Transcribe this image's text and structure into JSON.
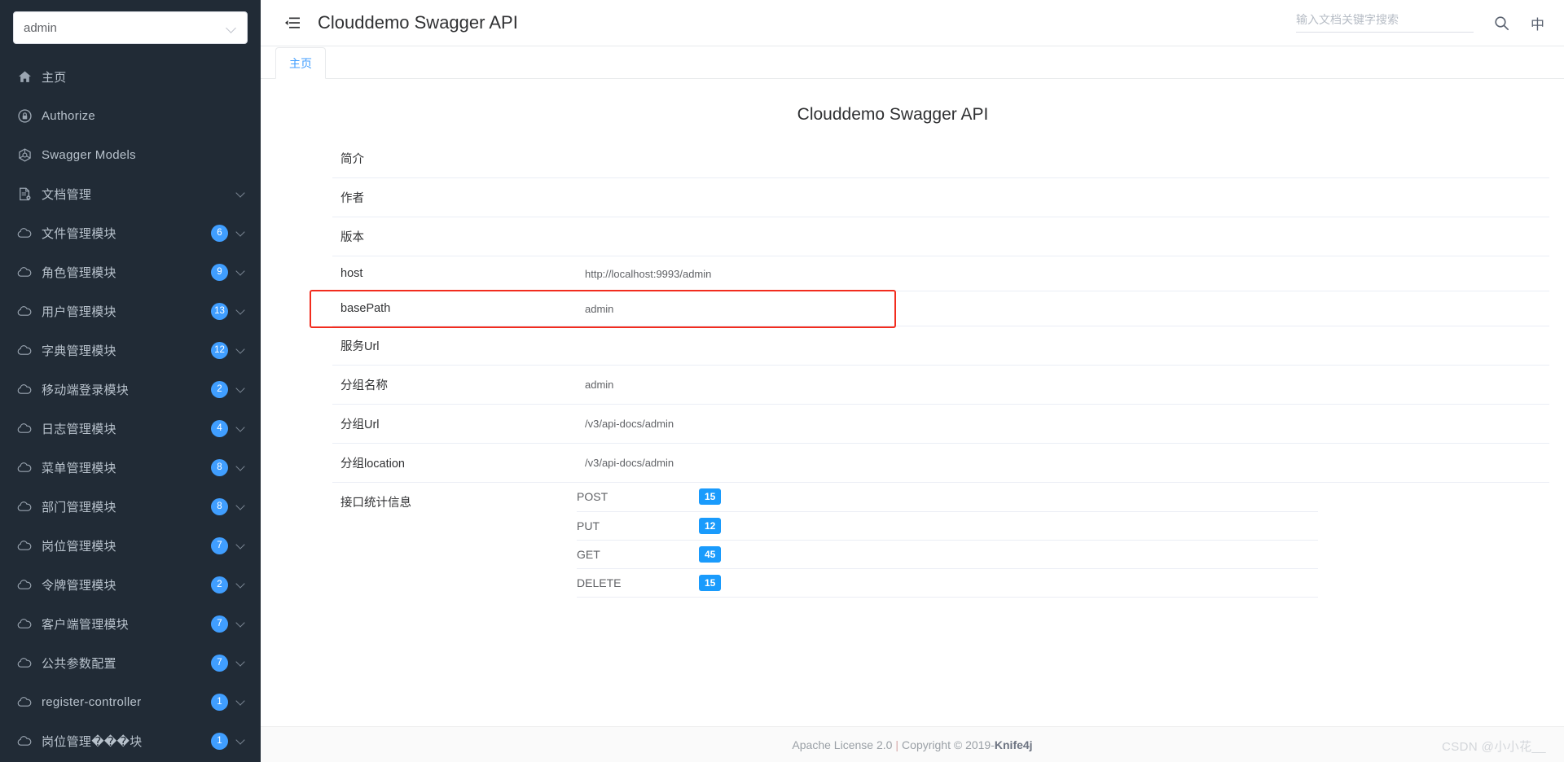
{
  "sidebar": {
    "group_select": {
      "value": "admin",
      "icon": "chevron-down-icon"
    },
    "items": [
      {
        "label": "主页",
        "icon": "home-icon",
        "badge": null,
        "chevron": false
      },
      {
        "label": "Authorize",
        "icon": "lock-icon",
        "badge": null,
        "chevron": false
      },
      {
        "label": "Swagger Models",
        "icon": "model-icon",
        "badge": null,
        "chevron": false
      },
      {
        "label": "文档管理",
        "icon": "document-icon",
        "badge": null,
        "chevron": true
      },
      {
        "label": "文件管理模块",
        "icon": "cloud-icon",
        "badge": "6",
        "chevron": true
      },
      {
        "label": "角色管理模块",
        "icon": "cloud-icon",
        "badge": "9",
        "chevron": true
      },
      {
        "label": "用户管理模块",
        "icon": "cloud-icon",
        "badge": "13",
        "chevron": true
      },
      {
        "label": "字典管理模块",
        "icon": "cloud-icon",
        "badge": "12",
        "chevron": true
      },
      {
        "label": "移动端登录模块",
        "icon": "cloud-icon",
        "badge": "2",
        "chevron": true
      },
      {
        "label": "日志管理模块",
        "icon": "cloud-icon",
        "badge": "4",
        "chevron": true
      },
      {
        "label": "菜单管理模块",
        "icon": "cloud-icon",
        "badge": "8",
        "chevron": true
      },
      {
        "label": "部门管理模块",
        "icon": "cloud-icon",
        "badge": "8",
        "chevron": true
      },
      {
        "label": "岗位管理模块",
        "icon": "cloud-icon",
        "badge": "7",
        "chevron": true
      },
      {
        "label": "令牌管理模块",
        "icon": "cloud-icon",
        "badge": "2",
        "chevron": true
      },
      {
        "label": "客户端管理模块",
        "icon": "cloud-icon",
        "badge": "7",
        "chevron": true
      },
      {
        "label": "公共参数配置",
        "icon": "cloud-icon",
        "badge": "7",
        "chevron": true
      },
      {
        "label": "register-controller",
        "icon": "cloud-icon",
        "badge": "1",
        "chevron": true
      },
      {
        "label": "岗位管理���块",
        "icon": "cloud-icon",
        "badge": "1",
        "chevron": true
      }
    ]
  },
  "topbar": {
    "collapse_icon": "menu-fold-icon",
    "title": "Clouddemo Swagger API",
    "search": {
      "placeholder": "输入文档关键字搜索",
      "value": ""
    },
    "search_icon": "search-icon",
    "lang_label": "中"
  },
  "tabs": [
    {
      "label": "主页",
      "active": true
    }
  ],
  "document": {
    "title": "Clouddemo Swagger API",
    "rows": [
      {
        "key": "简介",
        "value": ""
      },
      {
        "key": "作者",
        "value": ""
      },
      {
        "key": "版本",
        "value": ""
      },
      {
        "key": "host",
        "value": "http://localhost:9993/admin"
      },
      {
        "key": "basePath",
        "value": "admin",
        "highlighted": true
      },
      {
        "key": "服务Url",
        "value": ""
      },
      {
        "key": "分组名称",
        "value": "admin"
      },
      {
        "key": "分组Url",
        "value": "/v3/api-docs/admin"
      },
      {
        "key": "分组location",
        "value": "/v3/api-docs/admin"
      }
    ],
    "stats_label": "接口统计信息",
    "stats": [
      {
        "method": "POST",
        "count": "15"
      },
      {
        "method": "PUT",
        "count": "12"
      },
      {
        "method": "GET",
        "count": "45"
      },
      {
        "method": "DELETE",
        "count": "15"
      }
    ]
  },
  "footer": {
    "license": "Apache License 2.0",
    "separator": "|",
    "copyright": "Copyright",
    "copyright_symbol": "©",
    "year": "2019-",
    "brand": "Knife4j",
    "watermark": "CSDN @小小花__"
  },
  "colors": {
    "sidebar_bg": "#212b36",
    "accent": "#409eff",
    "badge_blue": "#1a9bfc",
    "highlight_red": "#f22c1e"
  }
}
